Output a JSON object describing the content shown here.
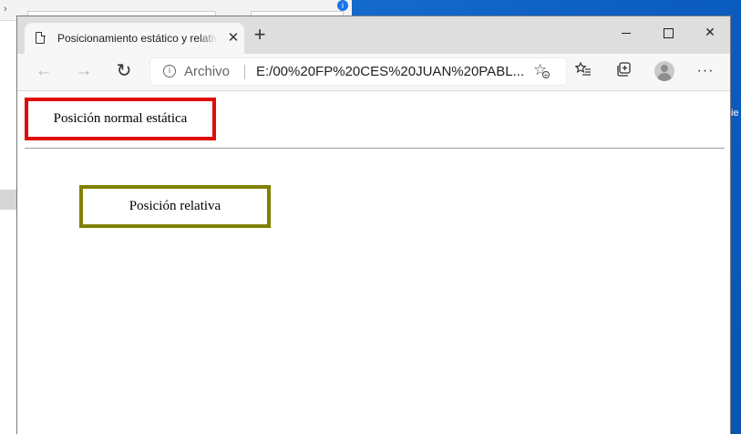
{
  "browser": {
    "tab": {
      "title": "Posicionamiento estático y relativo",
      "close_label": "✕"
    },
    "new_tab_label": "+",
    "window_controls": {
      "minimize_label": "",
      "maximize_label": "",
      "close_label": "✕"
    },
    "address_bar": {
      "scheme_label": "Archivo",
      "url": "E:/00%20FP%20CES%20JUAN%20PABL..."
    }
  },
  "page": {
    "static_box_text": "Posición normal estática",
    "relative_box_text": "Posición relativa"
  },
  "colors": {
    "static_border": "#e10a0a",
    "relative_border": "#808000"
  },
  "icons": [
    "page-icon",
    "close-icon",
    "plus-icon",
    "minimize-icon",
    "maximize-icon",
    "back-arrow-icon",
    "forward-arrow-icon",
    "refresh-icon",
    "info-icon",
    "add-favorite-icon",
    "favorites-icon",
    "collections-icon",
    "profile-icon",
    "more-icon"
  ]
}
